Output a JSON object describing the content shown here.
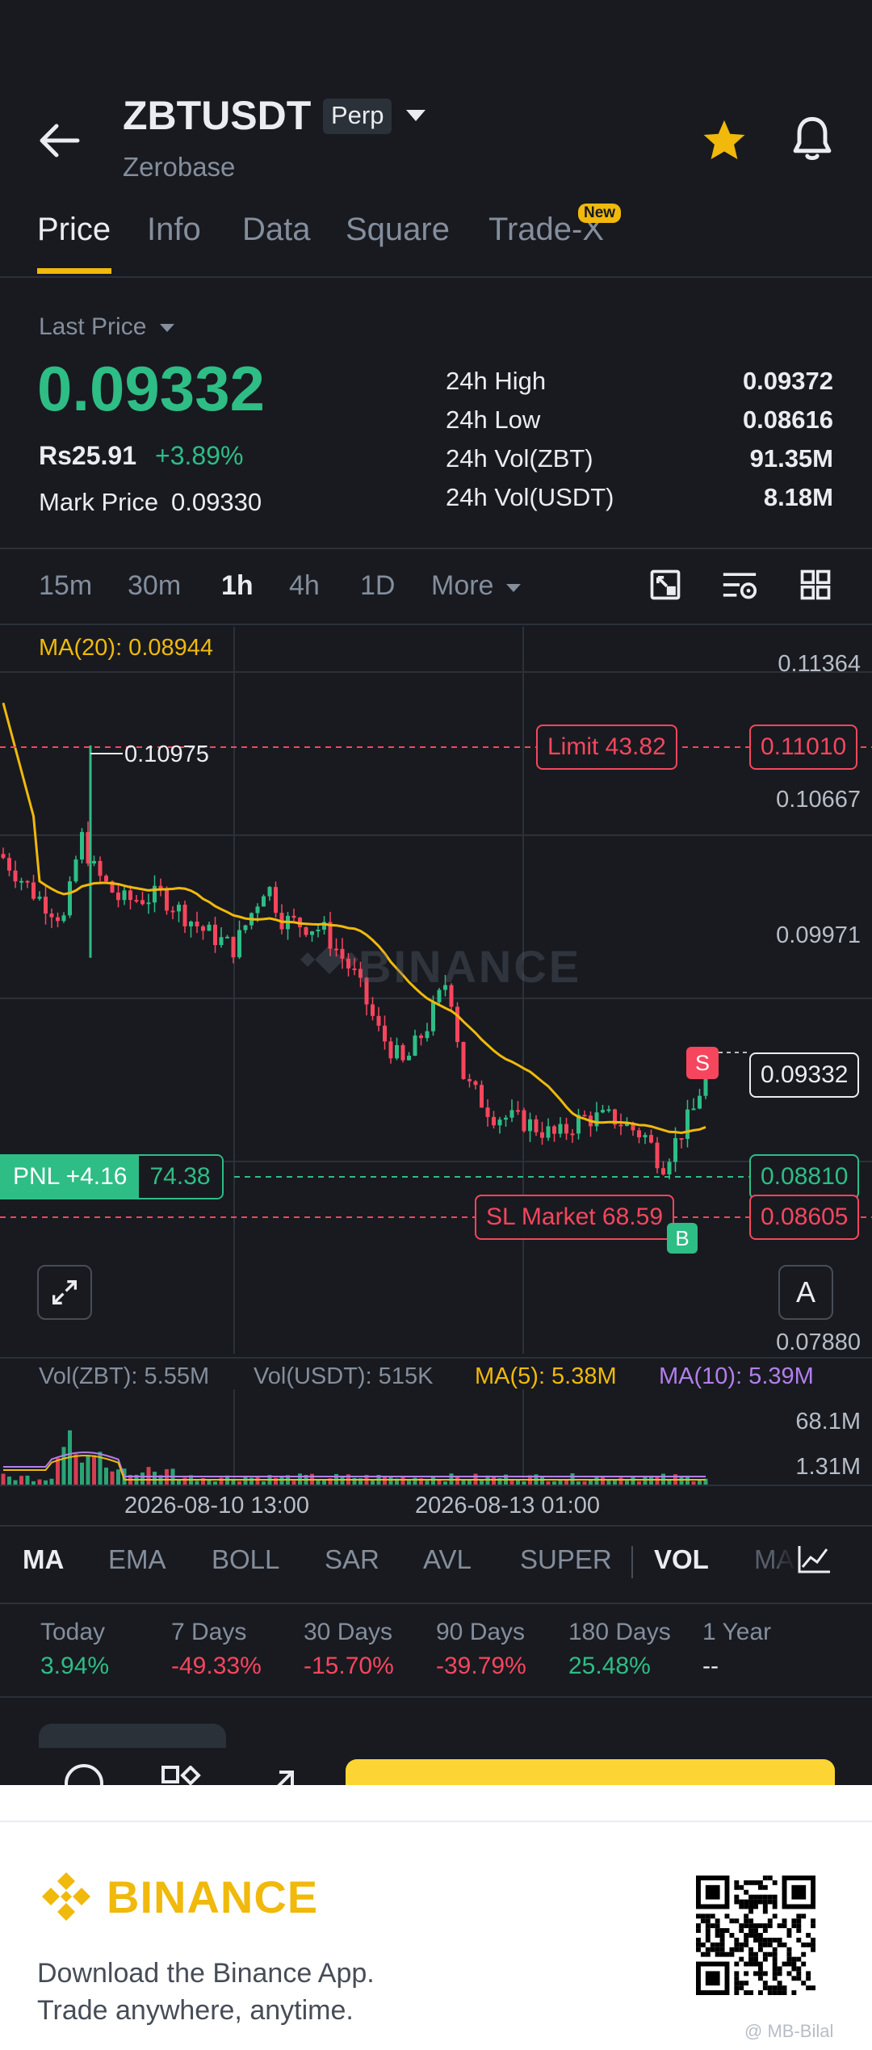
{
  "header": {
    "symbol": "ZBTUSDT",
    "contract_type": "Perp",
    "name": "Zerobase"
  },
  "tabs": [
    {
      "label": "Price",
      "active": true
    },
    {
      "label": "Info"
    },
    {
      "label": "Data"
    },
    {
      "label": "Square"
    },
    {
      "label": "Trade-X",
      "badge": "New"
    }
  ],
  "price": {
    "last_price_label": "Last Price",
    "last_price": "0.09332",
    "fiat_value": "Rs25.91",
    "change_pct": "+3.89%",
    "mark_price_label": "Mark Price",
    "mark_price": "0.09330"
  },
  "stats": [
    {
      "label": "24h High",
      "value": "0.09372"
    },
    {
      "label": "24h Low",
      "value": "0.08616"
    },
    {
      "label": "24h Vol(ZBT)",
      "value": "91.35M"
    },
    {
      "label": "24h Vol(USDT)",
      "value": "8.18M"
    }
  ],
  "timeframes": [
    "15m",
    "30m",
    "1h",
    "4h",
    "1D",
    "More"
  ],
  "active_timeframe": "1h",
  "chart": {
    "ma_label": "MA(20): 0.08944",
    "peak_label": "0.10975",
    "watermark": "BINANCE",
    "y_ticks": [
      "0.11364",
      "0.10667",
      "0.09971",
      "0.07880"
    ],
    "limit_order_label": "Limit 43.82",
    "limit_order_price": "0.11010",
    "current_price_tag": "0.09332",
    "pnl_label": "PNL +4.16",
    "pnl_qty": "74.38",
    "entry_price": "0.08810",
    "sl_label": "SL Market 68.59",
    "sl_price": "0.08605",
    "sell_marker": "S",
    "buy_marker": "B",
    "auto_scale_label": "A",
    "colors": {
      "up": "#2ebd85",
      "down": "#f6465d",
      "ma20": "#f0b90b",
      "ma10": "#b37feb"
    }
  },
  "volume": {
    "vol_zbt": "Vol(ZBT): 5.55M",
    "vol_usdt": "Vol(USDT): 515K",
    "ma5": "MA(5): 5.38M",
    "ma10": "MA(10): 5.39M",
    "y_top": "68.1M",
    "y_bottom": "1.31M"
  },
  "time_axis": [
    "2026-08-10 13:00",
    "2026-08-13 01:00"
  ],
  "indicators": [
    "MA",
    "EMA",
    "BOLL",
    "SAR",
    "AVL",
    "SUPER",
    "VOL",
    "MA"
  ],
  "performance": [
    {
      "label": "Today",
      "value": "3.94%",
      "tone": "up"
    },
    {
      "label": "7 Days",
      "value": "-49.33%",
      "tone": "down"
    },
    {
      "label": "30 Days",
      "value": "-15.70%",
      "tone": "down"
    },
    {
      "label": "90 Days",
      "value": "-39.79%",
      "tone": "down"
    },
    {
      "label": "180 Days",
      "value": "25.48%",
      "tone": "up"
    },
    {
      "label": "1 Year",
      "value": "--",
      "tone": "neutral"
    }
  ],
  "promo": {
    "brand": "BINANCE",
    "line1": "Download the Binance App.",
    "line2": "Trade anywhere, anytime.",
    "watermark_credit": "@ MB-Bilal"
  }
}
